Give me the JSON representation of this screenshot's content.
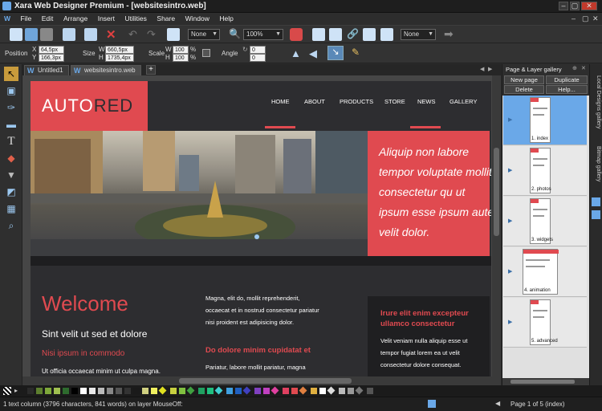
{
  "window": {
    "title": "Xara Web Designer Premium - [websitesintro.web]"
  },
  "menu": [
    "File",
    "Edit",
    "Arrange",
    "Insert",
    "Utilities",
    "Share",
    "Window",
    "Help"
  ],
  "toolbar": {
    "quality_value": "None",
    "zoom_value": "100%",
    "feather_value": "None"
  },
  "infobar": {
    "position_label": "Position",
    "x_label": "X",
    "y_label": "Y",
    "x_value": "64,5px",
    "y_value": "166,3px",
    "size_label": "Size",
    "w_label": "W",
    "h_label": "H",
    "w_value": "660,5px",
    "h_value": "1735,4px",
    "scale_label": "Scale",
    "scale_w": "100",
    "scale_h": "100",
    "percent": "%",
    "angle_label": "Angle",
    "angle_value": "0",
    "shear_value": "0"
  },
  "tabs": [
    {
      "label": "Untitled1"
    },
    {
      "label": "websitesintro.web"
    }
  ],
  "page": {
    "logo_a": "AUTO",
    "logo_b": "RED",
    "nav": [
      "HOME",
      "ABOUT",
      "PRODUCTS",
      "STORE",
      "NEWS",
      "GALLERY"
    ],
    "hero_quote": "Aliquip non labore tempor voluptate mollit consectetur qu ut ipsum esse ipsum aute velit dolor.",
    "welcome": "Welcome",
    "sub_heading": "Sint velit ut sed et dolore",
    "red_sub": "Nisi ipsum in commodo",
    "left_para": "Ut officia occaecat minim ut culpa magna.",
    "mid_para1": "Magna, elit do, mollit reprehenderit,",
    "mid_para2": "occaecat et in nostrud consectetur pariatur",
    "mid_para3": "nisi proident est adipisicing dolor.",
    "mid_heading": "Do dolore minim cupidatat et",
    "mid_para4": "Pariatur, labore mollit pariatur, magna",
    "side_heading1": "Irure elit enim excepteur",
    "side_heading2": "ullamco consectetur",
    "side_para1": "Velit veniam nulla aliquip esse ut",
    "side_para2": "tempor fugiat lorem ea ut velit",
    "side_para3": "consectetur dolore consequat."
  },
  "gallery": {
    "title": "Page & Layer gallery",
    "new_page": "New page",
    "duplicate": "Duplicate",
    "delete": "Delete",
    "help": "Help...",
    "pages": [
      "1. index",
      "2. photos",
      "3. widgets",
      "4. animation",
      "5. advanced"
    ]
  },
  "side_tabs": {
    "local_designs": "Local Designs gallery",
    "bitmap": "Bitmap gallery"
  },
  "status": {
    "left": "1 text column (3796 characters, 841 words) on layer MouseOff:",
    "right": "Page 1 of 5 (index)"
  },
  "colors": {
    "accent": "#e04a50",
    "selection": "#6aa8e8"
  }
}
